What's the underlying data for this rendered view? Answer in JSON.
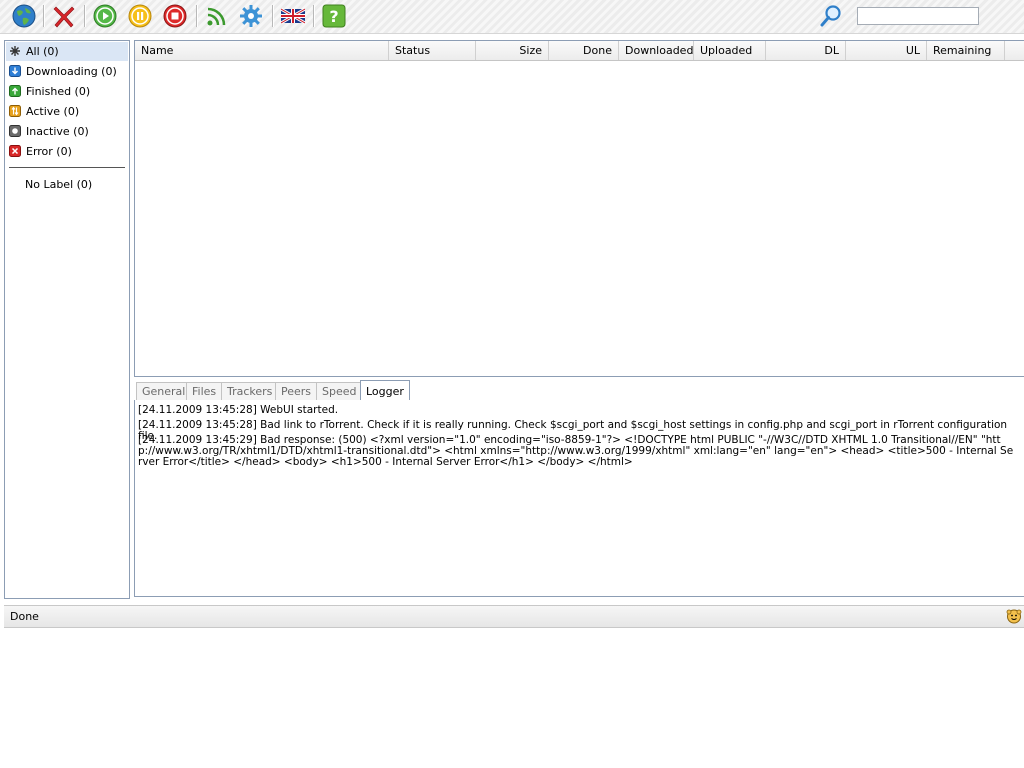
{
  "toolbar": {
    "icons": [
      "globe-icon",
      "remove-icon",
      "start-icon",
      "pause-icon",
      "stop-icon",
      "rss-icon",
      "settings-icon",
      "language-flag-icon",
      "help-icon",
      "search-icon"
    ],
    "search": {
      "value": "",
      "placeholder": ""
    }
  },
  "sidebar": {
    "items": [
      {
        "label": "All (0)",
        "icon": "all-icon",
        "selected": true
      },
      {
        "label": "Downloading (0)",
        "icon": "downloading-icon"
      },
      {
        "label": "Finished (0)",
        "icon": "finished-icon"
      },
      {
        "label": "Active (0)",
        "icon": "active-icon"
      },
      {
        "label": "Inactive (0)",
        "icon": "inactive-icon"
      },
      {
        "label": "Error (0)",
        "icon": "error-icon"
      }
    ],
    "no_label": "No Label (0)"
  },
  "list": {
    "columns": [
      "Name",
      "Status",
      "Size",
      "Done",
      "Downloaded",
      "Uploaded",
      "DL",
      "UL",
      "Remaining"
    ]
  },
  "tabs": {
    "items": [
      "General",
      "Files",
      "Trackers",
      "Peers",
      "Speed",
      "Logger"
    ],
    "active": "Logger"
  },
  "log": {
    "lines": [
      "[24.11.2009 13:45:28] WebUI started.",
      "[24.11.2009 13:45:28] Bad link to rTorrent. Check if it is really running. Check $scgi_port and $scgi_host settings in config.php and scgi_port in rTorrent configuration file.",
      "[24.11.2009 13:45:29] Bad response: (500) <?xml version=\"1.0\" encoding=\"iso-8859-1\"?> <!DOCTYPE html PUBLIC \"-//W3C//DTD XHTML 1.0 Transitional//EN\" \"http://www.w3.org/TR/xhtml1/DTD/xhtml1-transitional.dtd\"> <html xmlns=\"http://www.w3.org/1999/xhtml\" xml:lang=\"en\" lang=\"en\"> <head> <title>500 - Internal Server Error</title> </head> <body> <h1>500 - Internal Server Error</h1> </body> </html>"
    ]
  },
  "status": {
    "text": "Done",
    "icon": "smiley-icon"
  }
}
